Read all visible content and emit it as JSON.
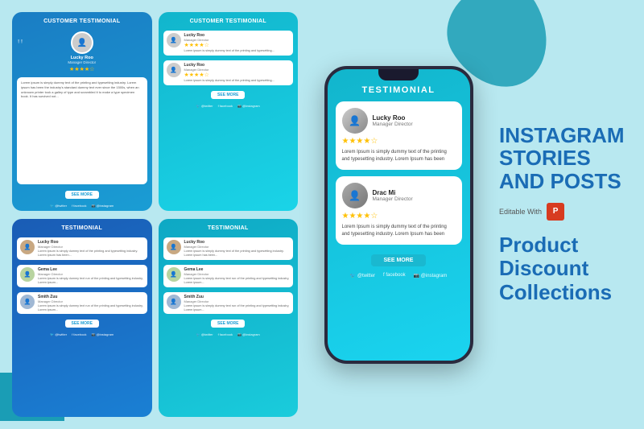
{
  "background_color": "#b8e8f0",
  "top_row_cards": [
    {
      "id": "card1",
      "header": "CUSTOMER\nTESTIMONIAL",
      "person_name": "Lucky Roo",
      "person_title": "Manager Director",
      "stars": "★★★★☆",
      "body_text": "Lorem ipsum is simply dummy text of the printing and typesetting industry. Lorem ipsum has been the industry's standard dummy text ever since the 1500s, when an unknown printer took a galley of type and scrambled it to make a type specimen book. It has survived not...",
      "see_more": "SEE MORE",
      "social": [
        "@twitter",
        "f facebook",
        "@ @instagram"
      ]
    },
    {
      "id": "card2",
      "header": "CUSTOMER\nTESTIMONIAL",
      "person_name": "Lucky Roo",
      "person_title": "Manager Director",
      "stars": "★★★★☆",
      "body_text1": "Lorem ipsum is simply dummy text of the printing and typesetting...",
      "body_text2": "Lorem ipsum is simply dummy text of the printing and typesetting...",
      "see_more": "SEE MORE",
      "social": [
        "@twitter",
        "f facebook",
        "@ @instagram"
      ]
    }
  ],
  "bottom_row_cards": [
    {
      "id": "card3",
      "header": "TESTIMONIAL",
      "people": [
        {
          "name": "Lucky Roo",
          "role": "Manager Director",
          "text": "Lorem ipsum is simply dummy text of the printing and typesetting industry. Lorem ipsum has been..."
        },
        {
          "name": "Gema Lee",
          "role": "Manager Director",
          "text": "Lorem ipsum is simply dummy text run of the printing and typesetting industry, Lorem ipsum..."
        },
        {
          "name": "Smith Zuu",
          "role": "Manager Director",
          "text": "Lorem ipsum is simply dummy text run of the printing and typesetting industry, Lorem ipsum..."
        }
      ],
      "see_more": "SEE MORE",
      "social": [
        "@twitter",
        "f facebook",
        "@ @instagram"
      ]
    },
    {
      "id": "card4",
      "header": "TESTIMONIAL",
      "people": [
        {
          "name": "Lucky Roo",
          "role": "Manager Director",
          "text": "Lorem ipsum is simply dummy text of the printing and typesetting industry. Lorem ipsum has been..."
        },
        {
          "name": "Gema Lee",
          "role": "Manager Director",
          "text": "Lorem ipsum is simply dummy text run of the printing and typesetting industry, Lorem ipsum..."
        },
        {
          "name": "Smith Zuu",
          "role": "Manager Director",
          "text": "Lorem ipsum is simply dummy text run of the printing and typesetting industry, Lorem ipsum..."
        }
      ],
      "see_more": "SEE MORE",
      "social": [
        "@twitter",
        "f facebook",
        "@ @instagram"
      ]
    }
  ],
  "phone": {
    "title": "TESTIMONIAL",
    "testimonials": [
      {
        "name": "Lucky Roo",
        "role": "Manager Director",
        "stars": "★★★★☆",
        "text": "Lorem Ipsum is simply dummy text of the printing and typesetting industry. Lorem Ipsum has been"
      },
      {
        "name": "Drac Mi",
        "role": "Manager Director",
        "stars": "★★★★☆",
        "text": "Lorem Ipsum is simply dummy text of the printing and typesetting industry. Lorem Ipsum has been"
      }
    ],
    "see_more": "SEE MORE",
    "social": [
      "@twitter",
      "f  facebook",
      "@ @instagram"
    ]
  },
  "right_section": {
    "main_title": "INSTAGRAM\nSTORIES\nAND POSTS",
    "editable_with": "Editable With",
    "powerpoint_label": "P",
    "product_lines": [
      "Product",
      "Discount",
      "Collections"
    ]
  }
}
